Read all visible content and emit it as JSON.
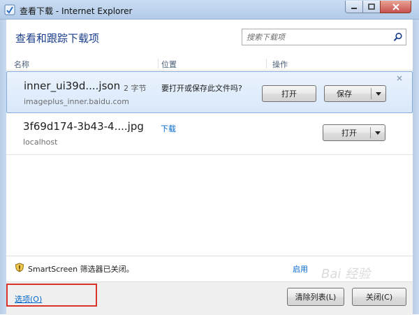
{
  "window": {
    "title": "查看下载 - Internet Explorer"
  },
  "header": {
    "title": "查看和跟踪下载项",
    "search_placeholder": "搜索下载项"
  },
  "columns": {
    "name": "名称",
    "location": "位置",
    "action": "操作"
  },
  "downloads": [
    {
      "filename": "inner_ui39d....json",
      "size": "2 字节",
      "host": "imageplus_inner.baidu.com",
      "location": "要打开或保存此文件吗?",
      "open_label": "打开",
      "save_label": "保存"
    },
    {
      "filename": "3f69d174-3b43-4....jpg",
      "host": "localhost",
      "location": "下载",
      "open_label": "打开"
    }
  ],
  "smartscreen": {
    "status": "SmartScreen 筛选器已关闭。",
    "enable_label": "启用"
  },
  "footer": {
    "options_label": "选项(O)",
    "clear_list_label": "清除列表(L)",
    "close_label": "关闭(C)"
  },
  "watermark": {
    "text": "Bai 经验"
  },
  "colors": {
    "accent": "#1a3e8c",
    "link": "#0066cc",
    "selected_bg": "#d9e8fa",
    "highlight_box": "#d9342b"
  }
}
